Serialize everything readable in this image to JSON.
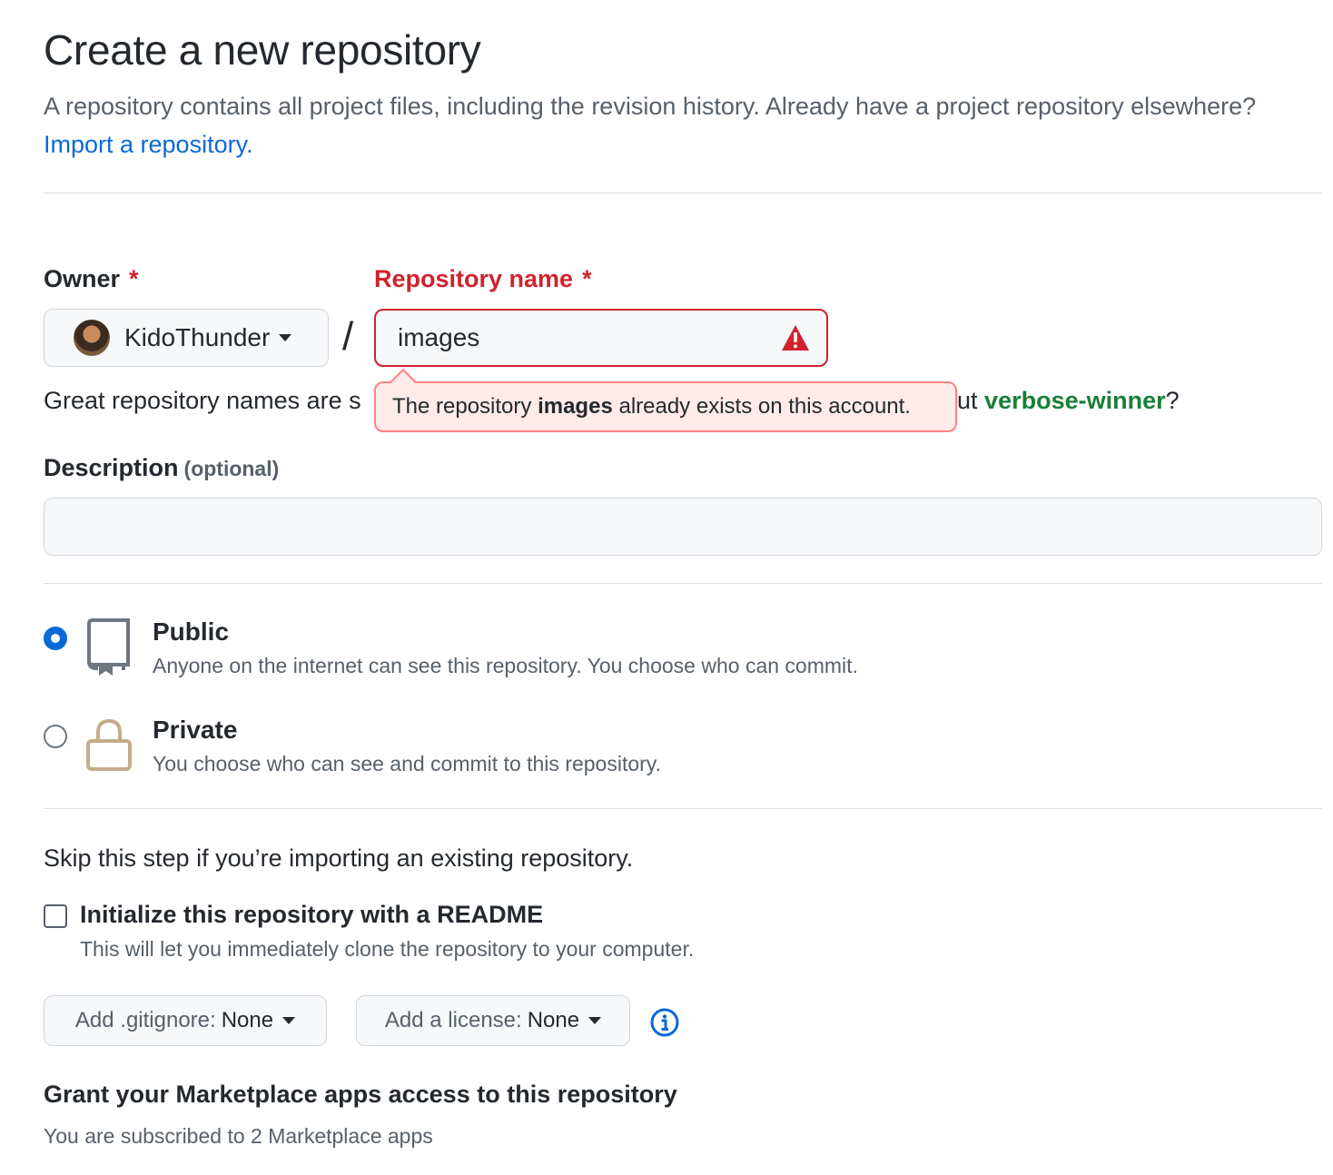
{
  "page": {
    "title": "Create a new repository",
    "intro_text": "A repository contains all project files, including the revision history. Already have a project repository elsewhere?",
    "import_link": "Import a repository."
  },
  "owner": {
    "label": "Owner",
    "required_mark": "*",
    "value": "KidoThunder"
  },
  "separator": "/",
  "repo_name": {
    "label": "Repository name",
    "required_mark": "*",
    "value": "images",
    "error_prefix": "The repository",
    "error_name": "images",
    "error_suffix": "already exists on this account."
  },
  "hint": {
    "text_start": "Great repository names are s",
    "text_end_prefix": "ut",
    "suggestion": "verbose-winner",
    "text_end_suffix": "?"
  },
  "description": {
    "label": "Description",
    "optional": "(optional)",
    "value": ""
  },
  "visibility": {
    "public": {
      "title": "Public",
      "subtitle": "Anyone on the internet can see this repository. You choose who can commit.",
      "selected": true
    },
    "private": {
      "title": "Private",
      "subtitle": "You choose who can see and commit to this repository.",
      "selected": false
    }
  },
  "init": {
    "skip_text": "Skip this step if you’re importing an existing repository.",
    "readme_label": "Initialize this repository with a README",
    "readme_sub": "This will let you immediately clone the repository to your computer.",
    "readme_checked": false
  },
  "gitignore": {
    "prefix": "Add .gitignore:",
    "value": "None"
  },
  "license": {
    "prefix": "Add a license:",
    "value": "None"
  },
  "marketplace": {
    "title": "Grant your Marketplace apps access to this repository",
    "subtitle": "You are subscribed to 2 Marketplace apps"
  },
  "colors": {
    "link": "#0969da",
    "error": "#cf222e",
    "success": "#1a7f37",
    "lock_icon": "#c4ad8a"
  }
}
